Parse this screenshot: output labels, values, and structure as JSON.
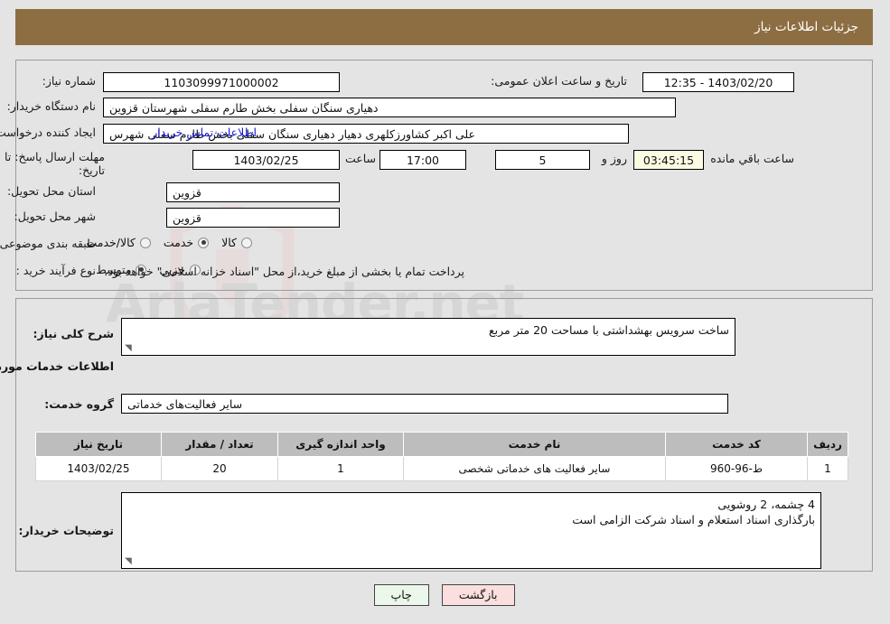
{
  "header": {
    "title": "جزئیات اطلاعات نیاز",
    "bg": "#8d6e43",
    "fg": "#ffffff"
  },
  "fields": {
    "need_number_label": "شماره نیاز:",
    "need_number_value": "1103099971000002",
    "public_announce_label": "تاریخ و ساعت اعلان عمومی:",
    "public_announce_value": "1403/02/20 - 12:35",
    "buyer_org_label": "نام دستگاه خریدار:",
    "buyer_org_value": "دهیاری سنگان سفلی بخش طارم سفلی شهرستان قزوین",
    "requester_label": "ایجاد کننده درخواست:",
    "requester_value": "علی اکبر کشاورزکلهری دهیار دهیاری سنگان سفلی بخش طارم سفلی شهرس",
    "contact_link": "اطلاعات تماس خریدار",
    "deadline_label": "مهلت ارسال پاسخ: تا تاریخ:",
    "deadline_date": "1403/02/25",
    "hour_label": "ساعت",
    "deadline_time": "17:00",
    "days_value": "5",
    "days_and_label": "روز و",
    "countdown_value": "03:45:15",
    "remaining_label": "ساعت باقي مانده",
    "province_label": "استان محل تحویل:",
    "province_value": "قزوین",
    "city_label": "شهر محل تحویل:",
    "city_value": "قزوین",
    "category_label": "طبقه بندی موضوعی:",
    "process_label": "نوع فرآیند خرید :",
    "treasury_note": "پرداخت تمام یا بخشی از مبلغ خرید،از محل \"اسناد خزانه اسلامی\" خواهد بود."
  },
  "category_options": [
    {
      "label": "کالا",
      "selected": false
    },
    {
      "label": "خدمت",
      "selected": true
    },
    {
      "label": "کالا/خدمت",
      "selected": false
    }
  ],
  "process_options": [
    {
      "label": "جزیي",
      "selected": false
    },
    {
      "label": "متوسط",
      "selected": true
    }
  ],
  "description": {
    "label": "شرح کلی نیاز:",
    "value": "ساخت سرویس بهشداشتی با مساحت 20 متر مربع"
  },
  "services_section": {
    "title": "اطلاعات خدمات مورد نیاز",
    "group_label": "گروه خدمت:",
    "group_value": "سایر فعالیت‌های خدماتی"
  },
  "table": {
    "columns": [
      "ردیف",
      "کد خدمت",
      "نام خدمت",
      "واحد اندازه گیری",
      "تعداد / مقدار",
      "تاریخ نیاز"
    ],
    "rows": [
      {
        "row": "1",
        "code": "ط-96-960",
        "name": "سایر فعالیت های خدماتی شخصی",
        "unit": "1",
        "quantity": "20",
        "need_date": "1403/02/25"
      }
    ]
  },
  "buyer_notes": {
    "label": "توضیحات خریدار:",
    "line1": "4 چشمه، 2 روشویی",
    "line2": "بارگذاری اسناد استعلام و اسناد شرکت الزامی است"
  },
  "buttons": {
    "print": "چاپ",
    "back": "بازگشت"
  },
  "watermark": {
    "text": "AriaTender.net"
  }
}
